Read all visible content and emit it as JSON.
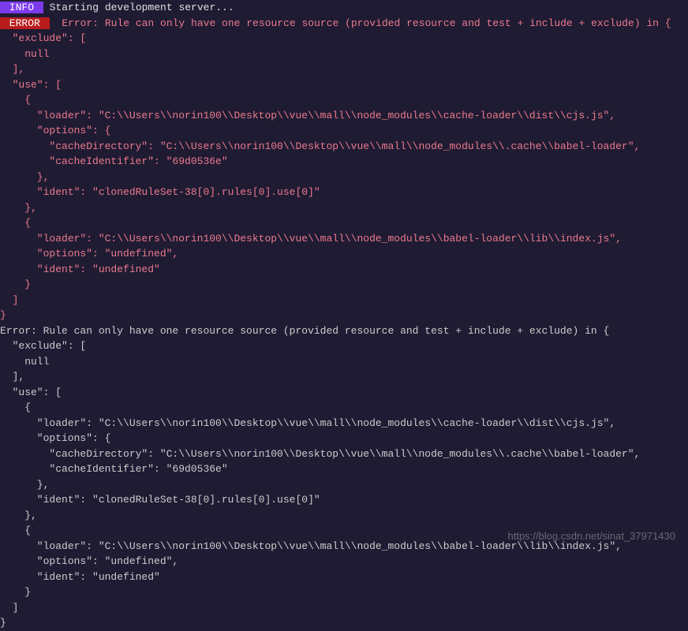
{
  "info_badge": " INFO ",
  "error_badge": " ERROR ",
  "info_message": " Starting development server...",
  "error_prefix": "  Error: Rule can only have one resource source (provided resource and test + include + exclude) in {",
  "error_lines": [
    "  \"exclude\": [",
    "    null",
    "  ],",
    "  \"use\": [",
    "    {",
    "      \"loader\": \"C:\\\\Users\\\\norin100\\\\Desktop\\\\vue\\\\mall\\\\node_modules\\\\cache-loader\\\\dist\\\\cjs.js\",",
    "      \"options\": {",
    "        \"cacheDirectory\": \"C:\\\\Users\\\\norin100\\\\Desktop\\\\vue\\\\mall\\\\node_modules\\\\.cache\\\\babel-loader\",",
    "        \"cacheIdentifier\": \"69d0536e\"",
    "      },",
    "      \"ident\": \"clonedRuleSet-38[0].rules[0].use[0]\"",
    "    },",
    "    {",
    "      \"loader\": \"C:\\\\Users\\\\norin100\\\\Desktop\\\\vue\\\\mall\\\\node_modules\\\\babel-loader\\\\lib\\\\index.js\",",
    "      \"options\": \"undefined\",",
    "      \"ident\": \"undefined\"",
    "    }",
    "  ]",
    "}"
  ],
  "normal_prefix": "Error: Rule can only have one resource source (provided resource and test + include + exclude) in {",
  "normal_lines": [
    "  \"exclude\": [",
    "    null",
    "  ],",
    "  \"use\": [",
    "    {",
    "      \"loader\": \"C:\\\\Users\\\\norin100\\\\Desktop\\\\vue\\\\mall\\\\node_modules\\\\cache-loader\\\\dist\\\\cjs.js\",",
    "      \"options\": {",
    "        \"cacheDirectory\": \"C:\\\\Users\\\\norin100\\\\Desktop\\\\vue\\\\mall\\\\node_modules\\\\.cache\\\\babel-loader\",",
    "        \"cacheIdentifier\": \"69d0536e\"",
    "      },",
    "      \"ident\": \"clonedRuleSet-38[0].rules[0].use[0]\"",
    "    },",
    "    {",
    "      \"loader\": \"C:\\\\Users\\\\norin100\\\\Desktop\\\\vue\\\\mall\\\\node_modules\\\\babel-loader\\\\lib\\\\index.js\",",
    "      \"options\": \"undefined\",",
    "      \"ident\": \"undefined\"",
    "    }",
    "  ]",
    "}"
  ],
  "watermark": "https://blog.csdn.net/sinat_37971430"
}
